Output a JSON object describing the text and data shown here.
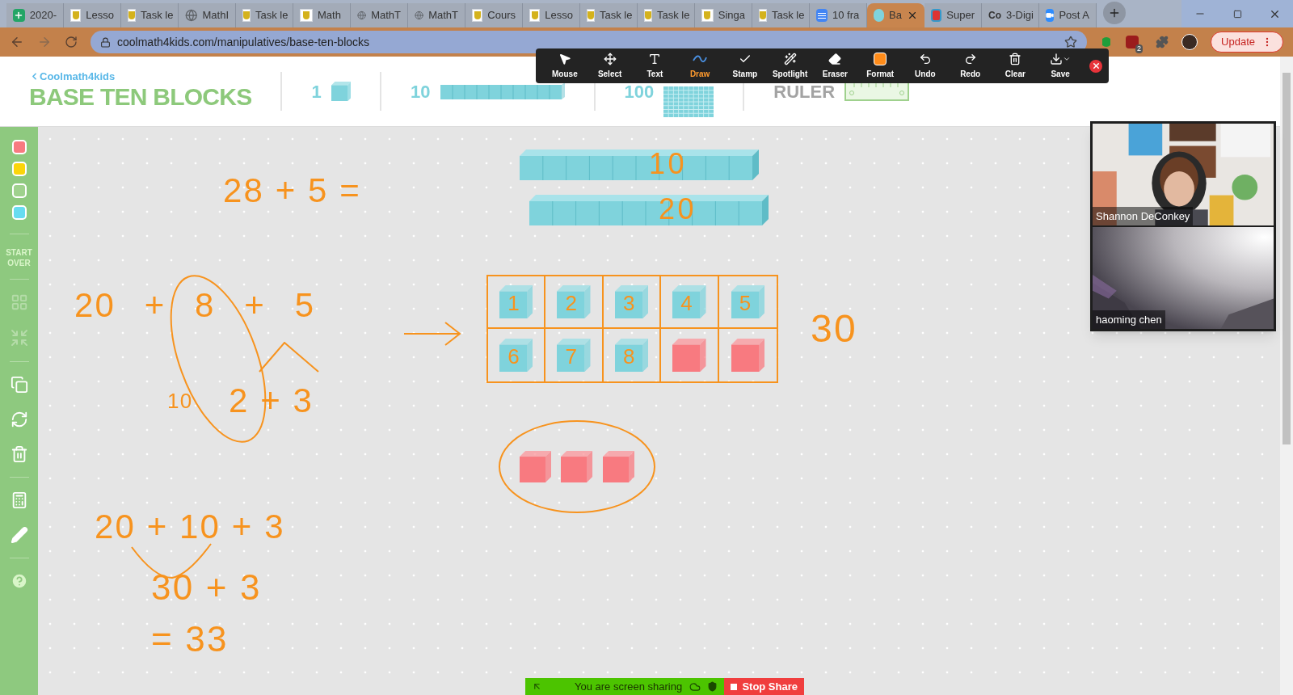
{
  "browser": {
    "tabs": [
      {
        "label": "2020-",
        "kind": "sheets",
        "selected": false
      },
      {
        "label": "Lesso",
        "kind": "school",
        "selected": false
      },
      {
        "label": "Task le",
        "kind": "school",
        "selected": false
      },
      {
        "label": "MathI",
        "kind": "globe",
        "selected": false
      },
      {
        "label": "Task le",
        "kind": "school",
        "selected": false
      },
      {
        "label": "Math",
        "kind": "school",
        "selected": false
      },
      {
        "label": "MathT",
        "kind": "globe",
        "selected": false
      },
      {
        "label": "MathT",
        "kind": "globe",
        "selected": false
      },
      {
        "label": "Cours",
        "kind": "school",
        "selected": false
      },
      {
        "label": "Lesso",
        "kind": "school",
        "selected": false
      },
      {
        "label": "Task le",
        "kind": "school",
        "selected": false
      },
      {
        "label": "Task le",
        "kind": "school",
        "selected": false
      },
      {
        "label": "Singa",
        "kind": "school",
        "selected": false
      },
      {
        "label": "Task le",
        "kind": "school",
        "selected": false
      },
      {
        "label": "10 fra",
        "kind": "docs",
        "selected": false
      },
      {
        "label": "Ba",
        "kind": "monster",
        "selected": true
      },
      {
        "label": "Super",
        "kind": "super",
        "selected": false
      },
      {
        "label": "3-Digi",
        "kind": "text",
        "icon_text": "Co",
        "selected": false
      },
      {
        "label": "Post A",
        "kind": "zoom",
        "selected": false
      }
    ],
    "address": "coolmath4kids.com/manipulatives/base-ten-blocks",
    "extension_badge": "2",
    "update_button": "Update"
  },
  "app": {
    "brand": "Coolmath4kids",
    "title": "BASE TEN BLOCKS",
    "palette": [
      {
        "label": "1",
        "kind": "unit"
      },
      {
        "label": "10",
        "kind": "rod"
      },
      {
        "label": "100",
        "kind": "flat"
      },
      {
        "label": "RULER",
        "kind": "ruler"
      }
    ],
    "colors": [
      {
        "color": "#f87a80",
        "selected": false
      },
      {
        "color": "#fbd50a",
        "selected": false
      },
      {
        "color": "#9fd18d",
        "selected": false
      },
      {
        "color": "#67dcf0",
        "selected": false
      }
    ],
    "start_over": "START OVER"
  },
  "annotation_toolbar": {
    "tools": [
      {
        "label": "Mouse",
        "kind": "mouse",
        "selected": false
      },
      {
        "label": "Select",
        "kind": "select",
        "selected": false
      },
      {
        "label": "Text",
        "kind": "text",
        "selected": false
      },
      {
        "label": "Draw",
        "kind": "draw",
        "selected": true
      },
      {
        "label": "Stamp",
        "kind": "stamp",
        "selected": false
      },
      {
        "label": "Spotlight",
        "kind": "spotlight",
        "selected": false
      },
      {
        "label": "Eraser",
        "kind": "eraser",
        "selected": false
      },
      {
        "label": "Format",
        "kind": "format",
        "selected": false
      },
      {
        "label": "Undo",
        "kind": "undo",
        "selected": false
      },
      {
        "label": "Redo",
        "kind": "redo",
        "selected": false
      },
      {
        "label": "Clear",
        "kind": "clear",
        "selected": false
      },
      {
        "label": "Save",
        "kind": "save",
        "selected": false
      }
    ]
  },
  "canvas": {
    "notes": [
      "28 + 5 =",
      "20 + 8 + 5",
      "10",
      "2 + 3",
      "20 + 10 + 3",
      "30 + 3",
      "= 33",
      "30"
    ],
    "rods": [
      {
        "label": "10"
      },
      {
        "label": "20"
      }
    ],
    "ten_frame": [
      {
        "label": "1",
        "color": "#7fd3dc"
      },
      {
        "label": "2",
        "color": "#7fd3dc"
      },
      {
        "label": "3",
        "color": "#7fd3dc"
      },
      {
        "label": "4",
        "color": "#7fd3dc"
      },
      {
        "label": "5",
        "color": "#7fd3dc"
      },
      {
        "label": "6",
        "color": "#7fd3dc"
      },
      {
        "label": "7",
        "color": "#7fd3dc"
      },
      {
        "label": "8",
        "color": "#7fd3dc"
      },
      {
        "color": "#f87a80"
      },
      {
        "color": "#f87a80"
      }
    ],
    "circled_cubes": [
      {
        "color": "#f87a80"
      },
      {
        "color": "#f87a80"
      },
      {
        "color": "#f87a80"
      }
    ]
  },
  "video": [
    {
      "name": "Shannon DeConkey",
      "kind": "room"
    },
    {
      "name": "haoming chen",
      "kind": "ceiling"
    }
  ],
  "share_bar": {
    "status": "You are screen sharing",
    "stop": "Stop Share"
  }
}
